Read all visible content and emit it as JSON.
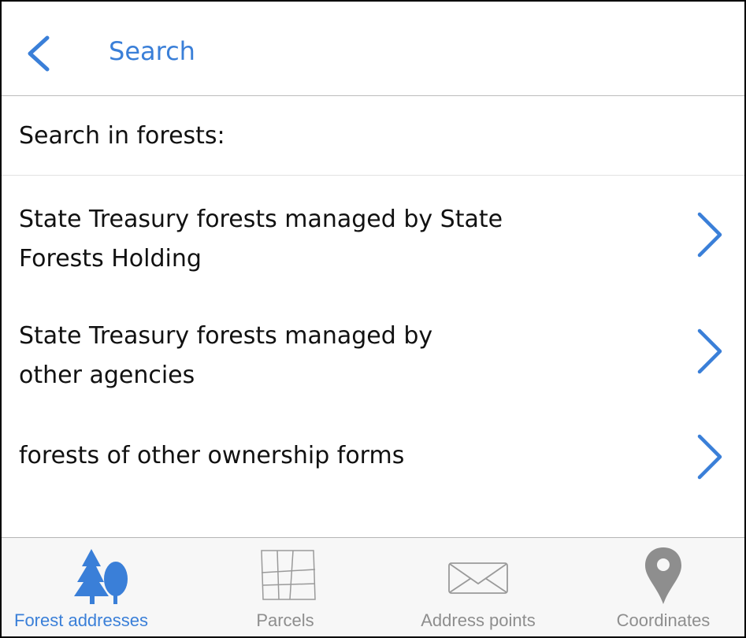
{
  "header": {
    "title": "Search"
  },
  "section": {
    "label": "Search in forests:"
  },
  "items": [
    {
      "line1": "State Treasury forests managed by State",
      "line2": "Forests Holding"
    },
    {
      "line1": "State Treasury forests managed by",
      "line2": "other agencies"
    },
    {
      "line1": "forests of other ownership forms",
      "line2": ""
    }
  ],
  "tabs": [
    {
      "label": "Forest addresses",
      "icon": "tree-icon",
      "active": true
    },
    {
      "label": "Parcels",
      "icon": "parcels-grid-icon",
      "active": false
    },
    {
      "label": "Address points",
      "icon": "envelope-icon",
      "active": false
    },
    {
      "label": "Coordinates",
      "icon": "location-pin-icon",
      "active": false
    }
  ],
  "colors": {
    "accent": "#3a7fd8",
    "inactive": "#8e8e8e"
  }
}
